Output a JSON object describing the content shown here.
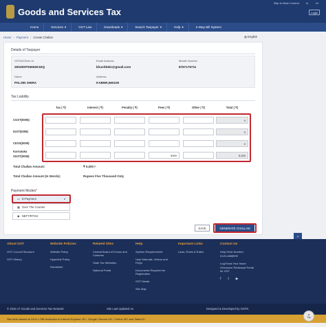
{
  "header": {
    "title": "Goods and Services Tax",
    "skip_link": "Skip to Main Content",
    "a_minus": "A-",
    "a_plus": "A+",
    "login": "Login"
  },
  "nav": {
    "items": [
      "Home",
      "Services",
      "GST Law",
      "Downloads",
      "Search Taxpayer",
      "Help",
      "e-Way Bill System"
    ]
  },
  "breadcrumb": {
    "items": [
      "Home",
      "Payment",
      "Create Challan"
    ],
    "language": "English"
  },
  "taxpayer": {
    "heading": "Details of Taxpayer",
    "gstin_label": "GSTIN/Other Id",
    "gstin_value": "29GDDPS5083K3ZQ",
    "email_label": "Email Address",
    "email_value": "khushb6in@gmail.com",
    "mobile_label": "Mobile Number",
    "mobile_value": "8767176711",
    "name_label": "Name",
    "name_value": "PALSIN SHIRA",
    "address_label": "Address",
    "address_value": "KABNR,560100"
  },
  "liability": {
    "heading": "Tax Liability",
    "columns": [
      "Tax ( ₹)",
      "Interest ( ₹)",
      "Penalty ( ₹)",
      "Fees ( ₹)",
      "Other ( ₹)",
      "Total ( ₹)"
    ],
    "rows": [
      {
        "label": "CGST(0005)",
        "values": [
          "",
          "",
          "",
          "",
          ""
        ],
        "total": "0"
      },
      {
        "label": "IGST(0008)",
        "values": [
          "",
          "",
          "",
          "",
          ""
        ],
        "total": "0"
      },
      {
        "label": "CESS(0009)",
        "values": [
          "",
          "",
          "",
          "",
          ""
        ],
        "total": "0"
      },
      {
        "label": "Karnataka",
        "label2": "SGST(0006)",
        "values": [
          "",
          "",
          "",
          "5000",
          ""
        ],
        "total": "5,000"
      }
    ],
    "total_amount_label": "Total Challan Amount:",
    "total_amount_value": "₹ 5,000 /-",
    "total_words_label": "Total Challan Amount (In Words):",
    "total_words_value": "Rupees Five Thousand Only"
  },
  "payment": {
    "heading": "Payment Modes",
    "required_mark": "*",
    "modes": [
      "E-Payment",
      "Over The Counter",
      "NEFT/RTGS"
    ],
    "save_label": "SAVE",
    "generate_label": "GENERATE CHALLAN"
  },
  "footer": {
    "columns": [
      {
        "heading": "About GST",
        "links": [
          "GST Council Structure",
          "GST History"
        ]
      },
      {
        "heading": "Website Policies",
        "links": [
          "Website Policy",
          "Hyperlink Policy",
          "Disclaimer"
        ]
      },
      {
        "heading": "Related Sites",
        "links": [
          "Central Board of Excise and Customs",
          "State Tax Websites",
          "National Portal"
        ]
      },
      {
        "heading": "Help",
        "links": [
          "System Requirements",
          "User Manuals, Videos and FAQs",
          "Documents Required for Registration",
          "GST Media",
          "Site Map"
        ]
      },
      {
        "heading": "Important Links",
        "links": [
          "Laws, Rules & Rates"
        ]
      },
      {
        "heading": "Contact Us",
        "links": [
          "Help Desk Number:",
          "0120-4888999",
          "Log/Track Your Issue:",
          "Grievance Redressal Portal for GST"
        ]
      }
    ],
    "copyright": "© 2016-17 Goods and Services Tax Network",
    "updated": "Site Last Updated on",
    "developed": "Designed & Developed by GSTN",
    "notice": "Site best viewed at 1024 x 768 resolution in Internet Explorer 10+, Google Chrome 49+, Firefox 45+ and Safari 6+",
    "top_label": "Top"
  },
  "colors": {
    "header": "#1e3a6e",
    "nav": "#2b4c88",
    "footer": "#1c2f59",
    "accent_red": "#c1272d",
    "footer_heading": "#e8a03a",
    "notice": "#d6a132"
  }
}
